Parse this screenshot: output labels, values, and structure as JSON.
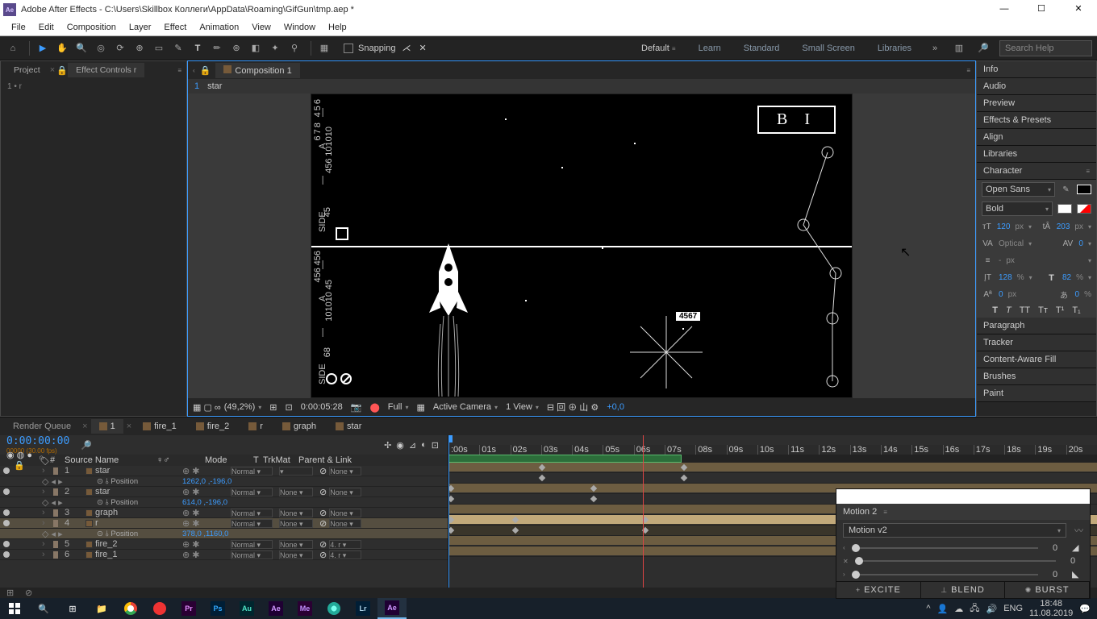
{
  "title": "Adobe After Effects - C:\\Users\\Skillbox Коллеги\\AppData\\Roaming\\GifGun\\tmp.aep *",
  "menu": [
    "File",
    "Edit",
    "Composition",
    "Layer",
    "Effect",
    "Animation",
    "View",
    "Window",
    "Help"
  ],
  "toolbar": {
    "snapping": "Snapping"
  },
  "workspaces": [
    "Default",
    "Learn",
    "Standard",
    "Small Screen",
    "Libraries"
  ],
  "search_placeholder": "Search Help",
  "project": {
    "tabs": [
      "Project",
      "Effect Controls r"
    ],
    "body": "1 • r"
  },
  "viewer": {
    "crumb_row": {
      "num": "1",
      "name": "star"
    },
    "tab": "Composition 1",
    "canvas": {
      "side_label": "SIDE",
      "a_label": "A",
      "nums": [
        "678",
        "456",
        "456",
        "101010",
        "45",
        "456",
        "456",
        "101010",
        "45",
        "68"
      ],
      "bi": "B I",
      "badge": "4567"
    },
    "footer": {
      "zoom": "(49,2%)",
      "time": "0:00:05:28",
      "res": "Full",
      "cam": "Active Camera",
      "view": "1 View",
      "exp": "+0,0"
    }
  },
  "rightpanels": [
    "Info",
    "Audio",
    "Preview",
    "Effects & Presets",
    "Align",
    "Libraries",
    "Character",
    "Paragraph",
    "Tracker",
    "Content-Aware Fill",
    "Brushes",
    "Paint"
  ],
  "char": {
    "font": "Open Sans",
    "weight": "Bold",
    "size": "120",
    "leading": "203",
    "track": "0",
    "optical": "Optical",
    "vscale": "128",
    "hscale": "82",
    "baseline": "0",
    "tsume": "0",
    "px": "px",
    "pct": "%",
    "stroke": "-"
  },
  "timeline": {
    "tabs": [
      "Render Queue",
      "1",
      "fire_1",
      "fire_2",
      "r",
      "graph",
      "star"
    ],
    "timecode": "0:00:00:00",
    "cols": [
      "#",
      "Source Name",
      "♀♂",
      "Mode",
      "T",
      "TrkMat",
      "Parent & Link"
    ],
    "layers": [
      {
        "n": "1",
        "name": "star",
        "mode": "Normal",
        "trk": "",
        "par": "None",
        "pos": "Position",
        "val": "1262,0 ,-196,0",
        "sel": false
      },
      {
        "n": "2",
        "name": "star",
        "mode": "Normal",
        "trk": "None",
        "par": "None",
        "pos": "Position",
        "val": "614,0 ,-196,0",
        "sel": false
      },
      {
        "n": "3",
        "name": "graph",
        "mode": "Normal",
        "trk": "None",
        "par": "None",
        "sel": false
      },
      {
        "n": "4",
        "name": "r",
        "mode": "Normal",
        "trk": "None",
        "par": "None",
        "pos": "Position",
        "val": "378,0 ,1160,0",
        "sel": true
      },
      {
        "n": "5",
        "name": "fire_2",
        "mode": "Normal",
        "trk": "None",
        "par": "4. r",
        "sel": false
      },
      {
        "n": "6",
        "name": "fire_1",
        "mode": "Normal",
        "trk": "None",
        "par": "4. r",
        "sel": false
      }
    ],
    "ruler": [
      ":00s",
      "01s",
      "02s",
      "03s",
      "04s",
      "05s",
      "06s",
      "07s",
      "08s",
      "09s",
      "10s",
      "11s",
      "12s",
      "13s",
      "14s",
      "15s",
      "16s",
      "17s",
      "18s",
      "19s",
      "20s"
    ]
  },
  "motion": {
    "title": "Motion 2",
    "preset": "Motion v2",
    "vals": [
      "0",
      "0",
      "0"
    ],
    "btns": [
      "EXCITE",
      "BLEND",
      "BURST"
    ]
  },
  "tray": {
    "lang": "ENG",
    "time": "18:48",
    "date": "11.08.2019"
  }
}
